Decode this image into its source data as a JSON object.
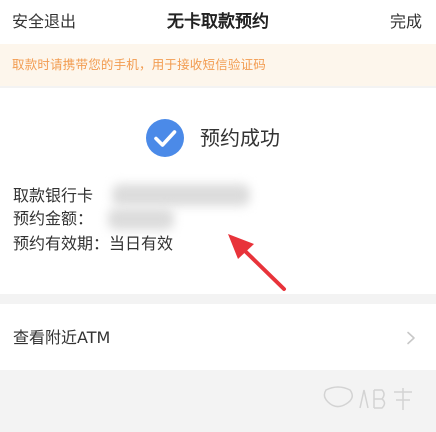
{
  "header": {
    "left_label": "安全退出",
    "title": "无卡取款预约",
    "right_label": "完成"
  },
  "notice": {
    "text": "取款时请携带您的手机，用于接收短信验证码"
  },
  "result": {
    "status_text": "预约成功",
    "status_icon": "check-circle-icon",
    "accent_color": "#4b8ae8"
  },
  "details": {
    "bank_card_label": "取款银行卡",
    "amount_label": "预约金额：",
    "validity_line": "预约有效期：当日有效"
  },
  "atm": {
    "label": "查看附近ATM",
    "chevron_icon": "chevron-right-icon"
  },
  "watermark": {
    "text": "Baidu经验"
  }
}
